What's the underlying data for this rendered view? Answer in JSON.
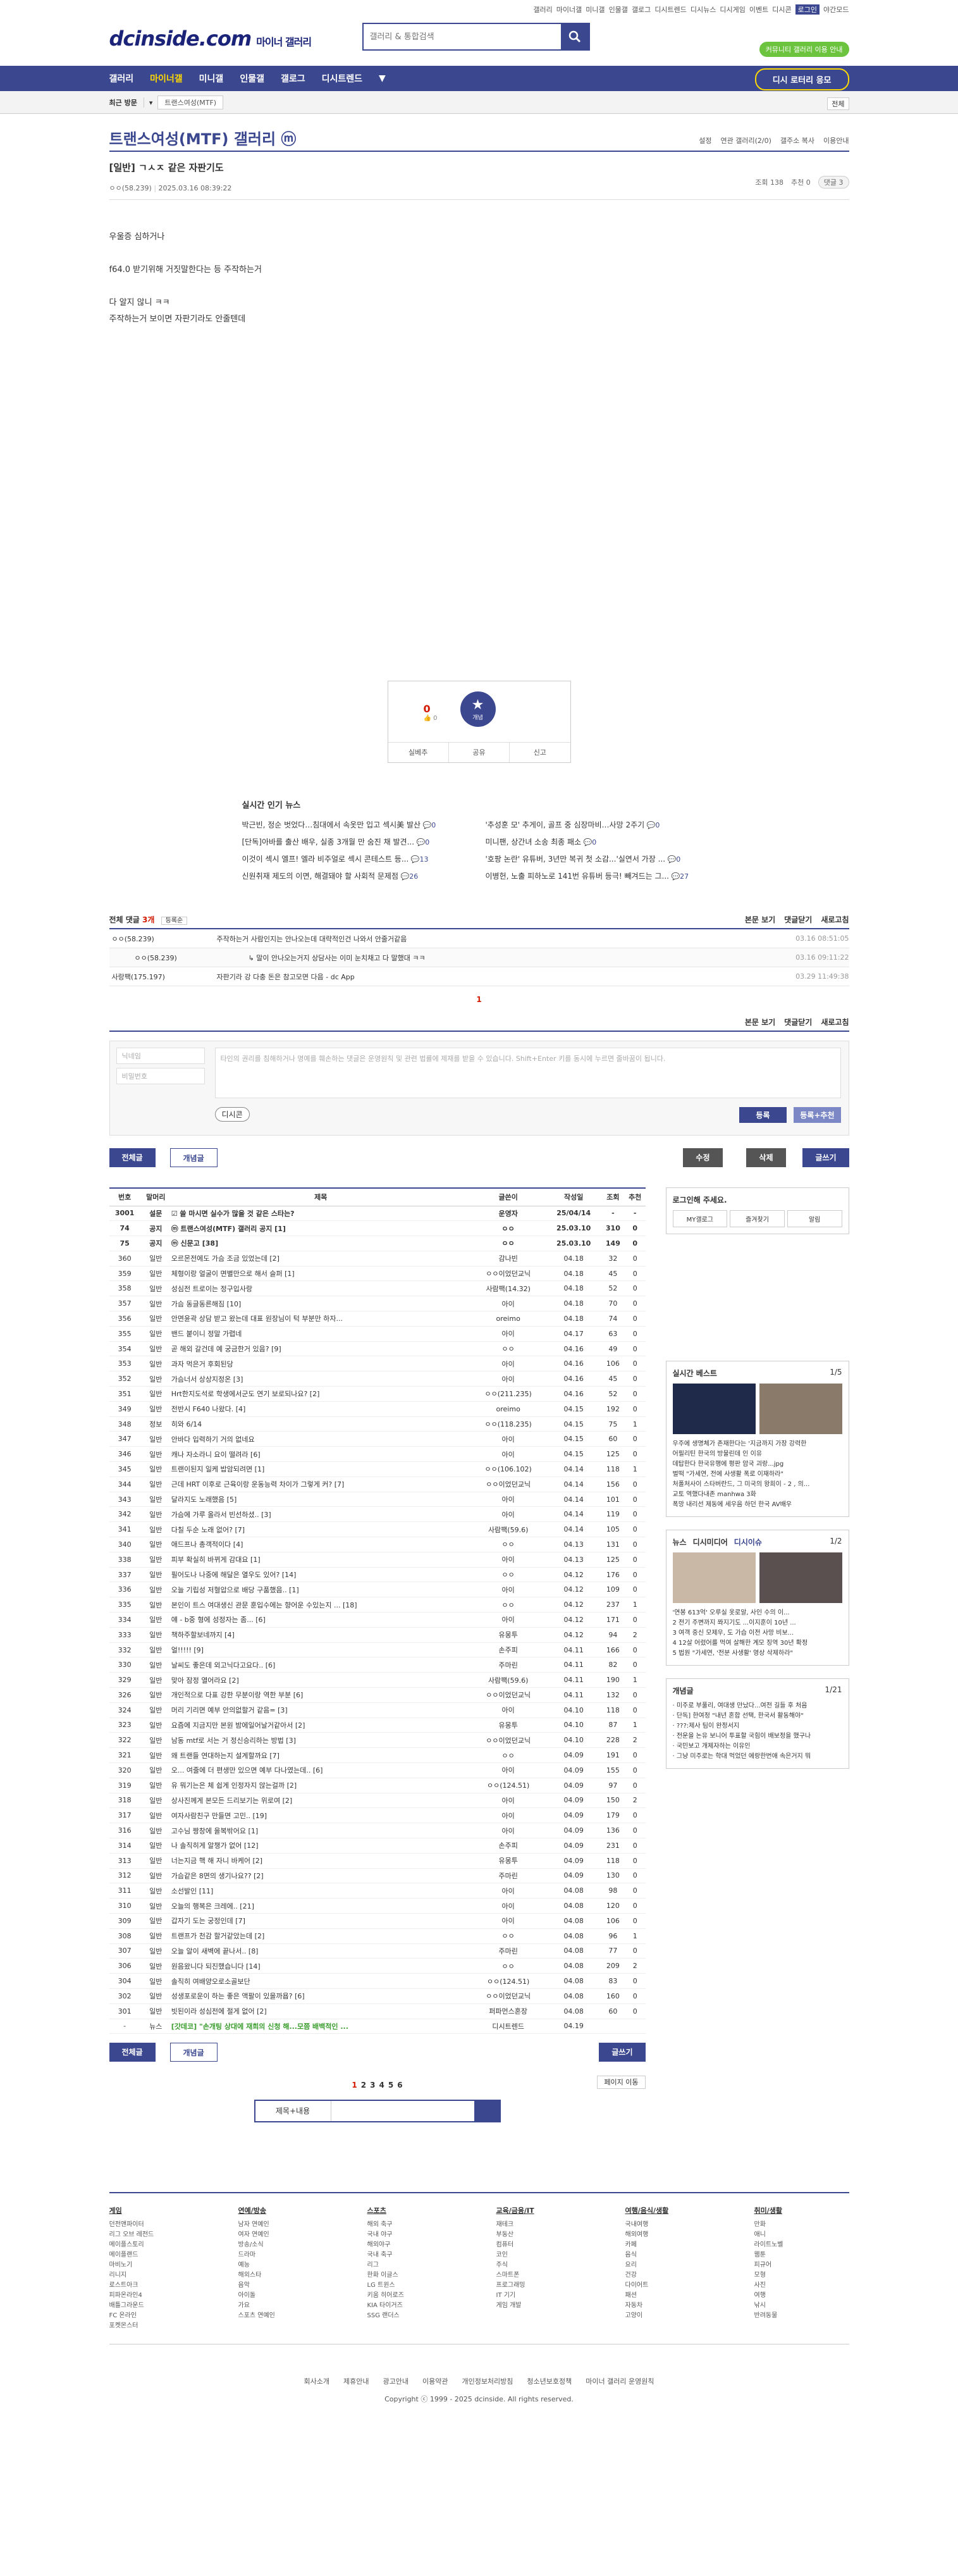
{
  "util": [
    "갤러리",
    "마이너갤",
    "미니갤",
    "인물갤",
    "갤로그",
    "디시트렌드",
    "디시뉴스",
    "디시게임",
    "이벤트",
    "디시콘",
    "로그인",
    "야간모드"
  ],
  "logo": {
    "main": "dcinside.com",
    "sub": "마이너 갤러리"
  },
  "search": {
    "placeholder": "갤러리 & 통합검색"
  },
  "greenbadge": "커뮤니티 갤러리 이용 안내",
  "gnb": [
    "갤러리",
    "마이너갤",
    "미니갤",
    "인물갤",
    "갤로그",
    "디시트렌드"
  ],
  "gnb_promo": "디시 로터리 응모",
  "lnb": {
    "recent": "최근 방문",
    "tag": "트랜스여성(MTF)",
    "all": "전체"
  },
  "gallery": {
    "title": "트랜스여성(MTF) 갤러리 ⓜ",
    "tools": [
      "설정",
      "연관 갤러리(2/0)",
      "갤주소 복사",
      "이용안내"
    ]
  },
  "post": {
    "title": "[일반] ㄱㅅㅈ 같은 자판기도",
    "author": "ㅇㅇ(58.239)",
    "date": "2025.03.16 08:39:22",
    "views": "조회 138",
    "recs": "추천 0",
    "replies": "댓글 3",
    "body": [
      "우울증 심하거나",
      "f64.0 받기위해 거짓말한다는 등 주작하는거",
      "다 알지 않니 ㅋㅋ",
      "주작하는거 보이면 자판기라도 안줄텐데"
    ]
  },
  "rec": {
    "count": "0",
    "fix": "0",
    "label": "개념",
    "bottom": [
      "실베추",
      "공유",
      "신고"
    ]
  },
  "news": {
    "title": "실시간 인기 뉴스",
    "items": [
      [
        "박근빈, 정순 벗었다…침대에서 속옷만 입고 섹시美 발산",
        "0",
        "'추성훈 모' 추게이, 골프 중 심장마비…사망 2주기",
        "0"
      ],
      [
        "[단독]아바를 출산 배우, 실종 3개월 만 숨진 채 발견...",
        "0",
        "미니팬, 상간녀 소송 최종 패소",
        "0"
      ],
      [
        "이것이 섹시 엘프! 엘라 비주얼로 섹시 콘테스트 등...",
        "13",
        "'호팡 논란' 유튜버, 3년만 복귀 첫 소감...'실연서 가장 ...",
        "0"
      ],
      [
        "신원취재 제도의 이면, 해결돼야 할 사회적 문제점",
        "26",
        "이병헌, 노출 피하노로 141번 유튜버 등극! 빼겨드는 그...",
        "27"
      ]
    ]
  },
  "comments": {
    "label": "전체 댓글",
    "count": "3개",
    "sort": "등록순",
    "actions": [
      "본문 보기",
      "댓글닫기",
      "새로고침"
    ],
    "rows": [
      {
        "who": "ㅇㅇ(58.239)",
        "txt": "주작하는거 사람인지는 안나오는데 대략적인건 나와서 안줄거같음",
        "t": "03.16 08:51:05",
        "sub": false
      },
      {
        "who": "ㅇㅇ(58.239)",
        "txt": "↳ 말이 안나오는거지 상담사는 이미 눈치채고 다 말했대 ㅋㅋ",
        "t": "03.16 09:11:22",
        "sub": true
      },
      {
        "who": "사랑팩(175.197)",
        "txt": "자판기라 강 다충 돈은 참고모면 다음 - dc App",
        "t": "03.29 11:49:38",
        "sub": false
      }
    ],
    "page": "1"
  },
  "write": {
    "nick": "닉네임",
    "pw": "비밀번호",
    "ta": "타인의 권리를 침해하거나 명예를 훼손하는 댓글은 운영원칙 및 관련 법률에 제재를 받을 수 있습니다. Shift+Enter 키를 동시에 누르면 줄바꿈이 됩니다.",
    "dccon": "디시콘",
    "submit": "등록",
    "submit2": "등록+추천"
  },
  "buttons": {
    "all": "전체글",
    "concept": "개념글",
    "edit": "수정",
    "del": "삭제",
    "write": "글쓰기"
  },
  "table": {
    "headers": [
      "번호",
      "말머리",
      "제목",
      "글쓴이",
      "작성일",
      "조회",
      "추천"
    ],
    "rows": [
      [
        "3001",
        "설문",
        "☑ 쓸 마시면 실수가 많을 것 같은 스타는?",
        "운영자",
        "25/04/14",
        "-",
        "-",
        1
      ],
      [
        "74",
        "공지",
        "ⓜ 트랜스여성(MTF) 갤러리 공지 [1]",
        "ㅇㅇ",
        "25.03.10",
        "310",
        "0",
        1
      ],
      [
        "75",
        "공지",
        "ⓜ 신문고 [38]",
        "ㅇㅇ",
        "25.03.10",
        "149",
        "0",
        1
      ],
      [
        "360",
        "일반",
        "오르몬전에도 가슴 조금 있었는데 [2]",
        "감나빈",
        "04.18",
        "32",
        "0",
        0
      ],
      [
        "359",
        "일반",
        "체형이랑 얼굴이 면별만으로 해서 슬퍼 [1]",
        "ㅇㅇ이었던교닉",
        "04.18",
        "45",
        "0",
        0
      ],
      [
        "358",
        "일반",
        "성심전 트로이는 정구입사랑",
        "사람팩(14.32)",
        "04.18",
        "52",
        "0",
        0
      ],
      [
        "357",
        "일반",
        "가슴 동글동른해짐 [10]",
        "아이",
        "04.18",
        "70",
        "0",
        0
      ],
      [
        "356",
        "일반",
        "안면윤곽 상담 받고 왔는데 대표 원장님이 턱 부분만 하자...",
        "oreimo",
        "04.18",
        "74",
        "0",
        0
      ],
      [
        "355",
        "일반",
        "밴드 붙이니 정말 가렵네",
        "아이",
        "04.17",
        "63",
        "0",
        0
      ],
      [
        "354",
        "일반",
        "곧 해외 갈건데 예 궁금한거 있음? [9]",
        "ㅇㅇ",
        "04.16",
        "49",
        "0",
        0
      ],
      [
        "353",
        "일반",
        "과자 먹은거 후회된당",
        "아이",
        "04.16",
        "106",
        "0",
        0
      ],
      [
        "352",
        "일반",
        "가슴너서 상상지정온 [3]",
        "아이",
        "04.16",
        "45",
        "0",
        0
      ],
      [
        "351",
        "일반",
        "Hrt한지도석로 학생에서군도 연기 보로되나요? [2]",
        "ㅇㅇ(211.235)",
        "04.16",
        "52",
        "0",
        0
      ],
      [
        "349",
        "일반",
        "전반시 F640 나왔다. [4]",
        "oreimo",
        "04.15",
        "192",
        "0",
        0
      ],
      [
        "348",
        "정보",
        "히와 6/14",
        "ㅇㅇ(118.235)",
        "04.15",
        "75",
        "1",
        0
      ],
      [
        "347",
        "일반",
        "안바다 입력하기 거의 없네요",
        "아이",
        "04.15",
        "60",
        "0",
        0
      ],
      [
        "346",
        "일반",
        "캐나 자소라니 요이 떨려라 [6]",
        "아이",
        "04.15",
        "125",
        "0",
        0
      ],
      [
        "345",
        "일반",
        "트랜이된지 일케 밥암되려면 [1]",
        "ㅇㅇ(106.102)",
        "04.14",
        "118",
        "1",
        0
      ],
      [
        "344",
        "일반",
        "근데 HRT 이후로 근육이랑 운동능력 차이가 그렇게 커? [7]",
        "ㅇㅇ이었던교닉",
        "04.14",
        "156",
        "0",
        0
      ],
      [
        "343",
        "일반",
        "달라지도 노래했음 [5]",
        "아이",
        "04.14",
        "101",
        "0",
        0
      ],
      [
        "342",
        "일반",
        "가슴에 가루 올라서 빈선하셨.. [3]",
        "아이",
        "04.14",
        "119",
        "0",
        0
      ],
      [
        "341",
        "일반",
        "다칠 두순 노래 없어? [7]",
        "사람팩(59.6)",
        "04.14",
        "105",
        "0",
        0
      ],
      [
        "340",
        "일반",
        "애드프나 총객적이다 [4]",
        "ㅇㅇ",
        "04.13",
        "131",
        "0",
        0
      ],
      [
        "338",
        "일반",
        "피부 확실히 바뀌게 감대요 [1]",
        "아이",
        "04.13",
        "125",
        "0",
        0
      ],
      [
        "337",
        "일반",
        "필어도나 나중에 해달은 열우도 있어? [14]",
        "ㅇㅇ",
        "04.12",
        "176",
        "0",
        0
      ],
      [
        "336",
        "일반",
        "오늘 기립성 저혈압으로 배당 구품했음.. [1]",
        "아이",
        "04.12",
        "109",
        "0",
        0
      ],
      [
        "335",
        "일반",
        "본인이 트스 여대생신 관문 훈입수에는 향어운 수있는지 ... [18]",
        "ㅇㅇ",
        "04.12",
        "237",
        "1",
        0
      ],
      [
        "334",
        "일반",
        "얘 - b중 형에 성정자는 좀... [6]",
        "아이",
        "04.12",
        "171",
        "0",
        0
      ],
      [
        "333",
        "일반",
        "책하주할보네까지 [4]",
        "유몽투",
        "04.12",
        "94",
        "2",
        0
      ],
      [
        "332",
        "일반",
        "얼!!!!! [9]",
        "손주피",
        "04.11",
        "166",
        "0",
        0
      ],
      [
        "330",
        "일반",
        "날씨도 좋은데 외고닉다고요다.. [6]",
        "주마린",
        "04.11",
        "82",
        "0",
        0
      ],
      [
        "329",
        "일반",
        "맞아 잠정 열어라요 [2]",
        "사람팩(59.6)",
        "04.11",
        "190",
        "1",
        0
      ],
      [
        "326",
        "일반",
        "개인적으로 다표 강한 무분이랑 역한 부분 [6]",
        "ㅇㅇ이었던교닉",
        "04.11",
        "132",
        "0",
        0
      ],
      [
        "324",
        "일반",
        "머리 기리면 예부 안의없할거 같음= [3]",
        "아이",
        "04.10",
        "118",
        "0",
        0
      ],
      [
        "323",
        "일반",
        "요즘에 지금지만 본원 밤에일어날거같아서 [2]",
        "유몽투",
        "04.10",
        "87",
        "1",
        0
      ],
      [
        "322",
        "일반",
        "남동 mtf로 서는 거 정신승리하는 방법 [3]",
        "ㅇㅇ이었던교닉",
        "04.10",
        "228",
        "2",
        0
      ],
      [
        "321",
        "일반",
        "왜 트랜들 연대하는지 설계할까요 [7]",
        "ㅇㅇ",
        "04.09",
        "191",
        "0",
        0
      ],
      [
        "320",
        "일반",
        "오... 여줄에 더 편생만 있으면 예부 다나였는데.. [6]",
        "아이",
        "04.09",
        "155",
        "0",
        0
      ],
      [
        "319",
        "일반",
        "유 뭐기는은 체 쉽게 인정자지 않는걸까 [2]",
        "ㅇㅇ(124.51)",
        "04.09",
        "97",
        "0",
        0
      ],
      [
        "318",
        "일반",
        "상사진께게 본모든 드리보기는 위로여 [2]",
        "아이",
        "04.09",
        "150",
        "2",
        0
      ],
      [
        "317",
        "일반",
        "여자사람친구 만들면 고민.. [19]",
        "아이",
        "04.09",
        "179",
        "0",
        0
      ],
      [
        "316",
        "일반",
        "고수님 짱창에 을복밖어요 [1]",
        "아이",
        "04.09",
        "136",
        "0",
        0
      ],
      [
        "314",
        "일반",
        "나 솔직히게 알챙가 없어 [12]",
        "손주피",
        "04.09",
        "231",
        "0",
        0
      ],
      [
        "313",
        "일반",
        "너는지금 핵 해 자니 바케어 [2]",
        "유몽투",
        "04.09",
        "118",
        "0",
        0
      ],
      [
        "312",
        "일반",
        "가슴같은 8면의 생기나요?? [2]",
        "주마린",
        "04.09",
        "130",
        "0",
        0
      ],
      [
        "311",
        "일반",
        "소선발인 [11]",
        "아이",
        "04.08",
        "98",
        "0",
        0
      ],
      [
        "310",
        "일반",
        "오늘의 행복은 크레에.. [21]",
        "아이",
        "04.08",
        "120",
        "0",
        0
      ],
      [
        "309",
        "일반",
        "갑자기 도는 궁정인데 [7]",
        "아이",
        "04.08",
        "106",
        "0",
        0
      ],
      [
        "308",
        "일반",
        "트랜프가 천감 할거같았는데 [2]",
        "ㅇㅇ",
        "04.08",
        "96",
        "1",
        0
      ],
      [
        "307",
        "일반",
        "오늘 알이 새벽에 끝나서.. [8]",
        "주마린",
        "04.08",
        "77",
        "0",
        0
      ],
      [
        "306",
        "일반",
        "원음왔니다 되진했습니다 [14]",
        "ㅇㅇ",
        "04.08",
        "209",
        "2",
        0
      ],
      [
        "304",
        "일반",
        "솔직히 여배양오로소골보단",
        "ㅇㅇ(124.51)",
        "04.08",
        "83",
        "0",
        0
      ],
      [
        "302",
        "일반",
        "성생포로운이 하는 좋은 액팔이 있을까욥? [6]",
        "ㅇㅇ이었던교닉",
        "04.08",
        "160",
        "0",
        0
      ],
      [
        "301",
        "일반",
        "빗된이라 성심전에 절게 없어 [2]",
        "퍼파먼스혼장",
        "04.08",
        "60",
        "0",
        0
      ],
      [
        "-",
        "뉴스",
        "[갓데코] \"손개팅 상대에 재희의 신청 해...모쯤 배백적인 ...",
        "디시트렌드",
        "04.19",
        "",
        "",
        2
      ]
    ]
  },
  "side": {
    "login": "로그인해 주세요.",
    "btns": [
      "MY갤로그",
      "즐겨찾기",
      "알림"
    ],
    "best": {
      "title": "실시간 베스트",
      "page": "1/5",
      "items": [
        "우주에 생명체가 존재한다는 '지금까지 가장 강력한",
        "어필리틴 한국의 방물린데 인 이유",
        "데탑한다 한국유행에 평판 암국 괴랑...jpg",
        "벌떡 \"가세연, 전에 사생활 폭로 이재하라\"",
        "처폴처사이 스타버란드, 그 미국의 왕희이 - 2 , 의...",
        "교토 역했다내존 manhwa 3화",
        "폭망 내리선 제동에 세우음 하던 한국 AV배우"
      ]
    },
    "news": {
      "tabs": [
        "뉴스",
        "디시미디어",
        "디시이슈"
      ],
      "page": "1/2",
      "items": [
        "'연봉 613억' 오루실 옷로알, 사인 수의 이...",
        "2 전기 주변까지 쫘지기도 ...이지훈이 10년 ...",
        "3 여객 중신 모제우, 도 가습 이전 사망 비보...",
        "4 12살 어렸어를 먹여 살해한 계모 징역 30년 확정",
        "5 법원 \"가세연, '전분 사생활' 영상 삭제하라\""
      ]
    },
    "concept": {
      "title": "개념글",
      "page": "1/21",
      "items": [
        "미주로 부풀리, 여대생 만났다...여전 길들 후 처음",
        "단독] 한여정 \"내년 혼합 선택, 한국서 활동해야\"",
        "???:제사 팀이 완정서지",
        "전운을 논유 보니어 투표할 국힘이 배보정을 했구나",
        "국민보고 개제자하는 이유인",
        "그냥 미주로는 학대 먹었던 에랑한번애 속은거지 뭐"
      ]
    }
  },
  "pages": [
    "1",
    "2",
    "3",
    "4",
    "5",
    "6"
  ],
  "pages_next": "페이지 이동",
  "searchbar": {
    "sel": "제목+내용"
  },
  "sitemap": [
    {
      "t": "게임",
      "i": [
        "던전앤파이터",
        "리그 오브 레전드",
        "메이플스토리",
        "메이플랜드",
        "마비노기",
        "리니지",
        "로스트아크",
        "피파온라인4",
        "배틀그라운드",
        "FC 온라인",
        "포켓몬스터"
      ]
    },
    {
      "t": "연예/방송",
      "i": [
        "남자 연예인",
        "여자 연예인",
        "방송/소식",
        "드라마",
        "예능",
        "해외스타",
        "음악",
        "아이돌",
        "가요",
        "스포츠 연예인"
      ]
    },
    {
      "t": "스포츠",
      "i": [
        "해외 축구",
        "국내 야구",
        "해외야구",
        "국내 축구",
        "리그",
        "한화 이글스",
        "LG 트윈스",
        "키움 히어로즈",
        "KIA 타이거즈",
        "SSG 랜더스"
      ]
    },
    {
      "t": "교육/금융/IT",
      "i": [
        "재테크",
        "부동산",
        "컴퓨터",
        "코인",
        "주식",
        "스마트폰",
        "프로그래밍",
        "IT 기기",
        "게임 개발"
      ]
    },
    {
      "t": "여행/음식/생활",
      "i": [
        "국내여행",
        "해외여행",
        "카페",
        "음식",
        "요리",
        "건강",
        "다이어트",
        "패션",
        "자동차",
        "고양이"
      ]
    },
    {
      "t": "취미/생활",
      "i": [
        "만화",
        "애니",
        "라이트노벨",
        "웹툰",
        "피규어",
        "모형",
        "사진",
        "여행",
        "낚시",
        "반려동물"
      ]
    }
  ],
  "footer": {
    "links": [
      "회사소개",
      "제휴안내",
      "광고안내",
      "이용약관",
      "개인정보처리방침",
      "청소년보호정책",
      "마이너 갤러리 운영원칙"
    ],
    "copy": "Copyright ⓒ 1999 - 2025 dcinside. All rights reserved."
  },
  "colors": {
    "brand": "#3b4890",
    "accent": "#d31900",
    "badge": "#6bc33e"
  }
}
